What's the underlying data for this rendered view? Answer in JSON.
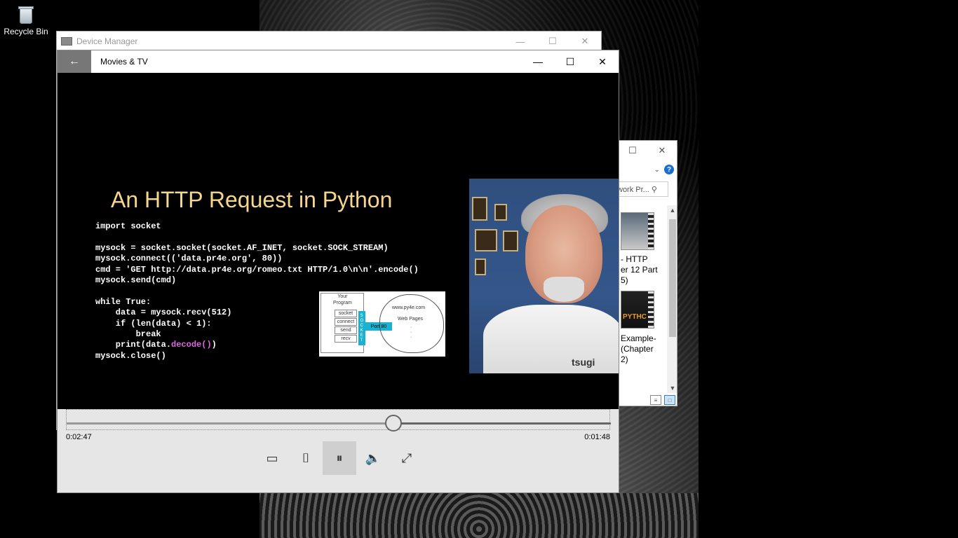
{
  "desktop": {
    "recycle_bin_label": "Recycle Bin"
  },
  "device_manager": {
    "title": "Device Manager",
    "controls": {
      "minimize": "—",
      "maximize": "☐",
      "close": "✕"
    }
  },
  "explorer": {
    "controls": {
      "maximize": "☐",
      "close": "✕"
    },
    "search_placeholder": "work Pr... ⚲",
    "items": [
      {
        "text": "- HTTP\ner 12 Part\n5)"
      },
      {
        "text": "Example-\n(Chapter\n2)"
      }
    ],
    "thumb2_text": "PYTHC"
  },
  "movies_tv": {
    "title": "Movies & TV",
    "back_icon": "←",
    "controls": {
      "minimize": "—",
      "maximize": "☐",
      "close": "✕"
    },
    "slide": {
      "title": "An HTTP Request in Python",
      "code_lines": [
        "import socket",
        "",
        "mysock = socket.socket(socket.AF_INET, socket.SOCK_STREAM)",
        "mysock.connect(('data.pr4e.org', 80))",
        "cmd = 'GET http://data.pr4e.org/romeo.txt HTTP/1.0\\n\\n'.encode()",
        "mysock.send(cmd)",
        "",
        "while True:",
        "    data = mysock.recv(512)",
        "    if (len(data) < 1):",
        "        break",
        "    print(data."
      ],
      "code_highlight": "decode()",
      "code_after_highlight": ")",
      "code_last": "mysock.close()",
      "diagram": {
        "program_label": "Your\nProgram",
        "functions": [
          "socket",
          "connect",
          "send",
          "recv"
        ],
        "socket_label": "S\nO\nC\nK\nE\nT",
        "port_label": "Port 80",
        "host": "www.py4e.com",
        "pages": "Web Pages",
        "dots": "·\n·\n·"
      },
      "webcam_logo": "tsugi"
    },
    "progress": 0.6,
    "time_elapsed": "0:02:47",
    "time_remaining": "0:01:48",
    "buttons": {
      "cast": "▭",
      "mini_view": "⌷",
      "pause": "⏸",
      "volume": "🔈",
      "fullscreen": "⤢"
    }
  }
}
